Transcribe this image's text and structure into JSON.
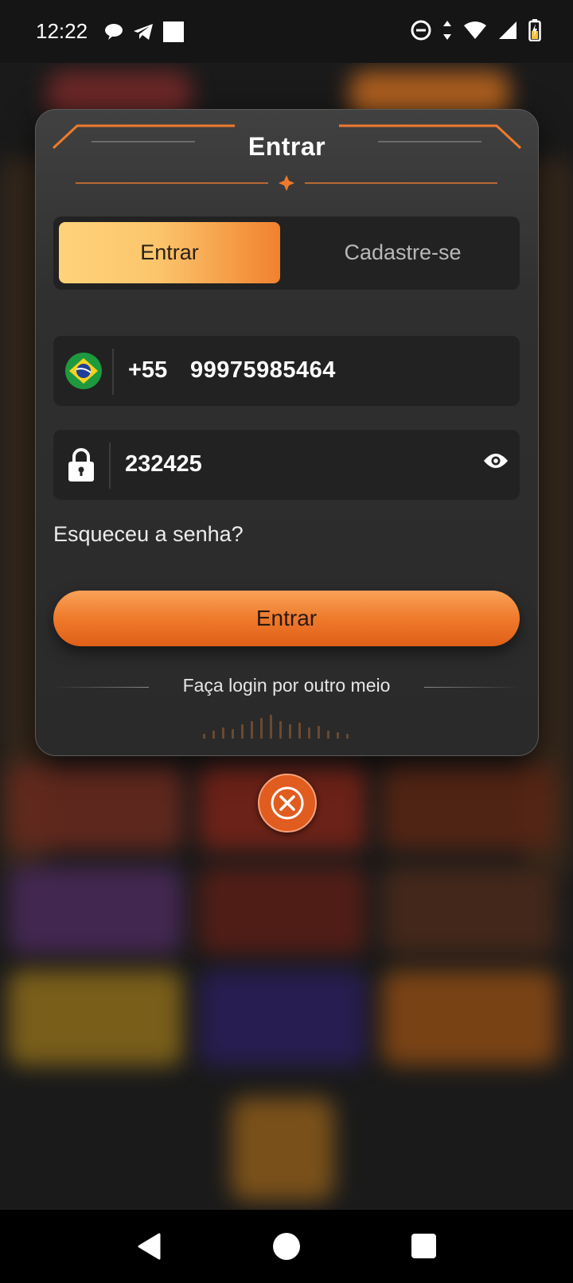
{
  "status_bar": {
    "time": "12:22",
    "left_icons": [
      "chat-bubble-icon",
      "telegram-icon",
      "square-notification-icon"
    ],
    "right_icons": [
      "do-not-disturb-icon",
      "data-arrows-icon",
      "wifi-icon",
      "cellular-signal-icon",
      "battery-charging-icon"
    ]
  },
  "modal": {
    "title": "Entrar",
    "tabs": [
      {
        "label": "Entrar",
        "active": true
      },
      {
        "label": "Cadastre-se",
        "active": false
      }
    ],
    "phone": {
      "country_icon": "brazil-flag-icon",
      "country_code": "+55",
      "value": "99975985464"
    },
    "password": {
      "icon": "lock-icon",
      "value": "232425",
      "toggle_icon": "eye-icon"
    },
    "forgot_label": "Esqueceu a senha?",
    "submit_label": "Entrar",
    "alt_login_label": "Faça login por outro meio"
  },
  "close_icon": "close-circle-icon",
  "colors": {
    "accent": "#ef7a2c",
    "tab_active_start": "#ffd37a",
    "tab_active_end": "#f1812f",
    "modal_bg": "#2f2f2f",
    "field_bg": "#222222"
  },
  "nav_bar": {
    "icons": [
      "back-triangle-icon",
      "home-circle-icon",
      "recents-square-icon"
    ]
  }
}
